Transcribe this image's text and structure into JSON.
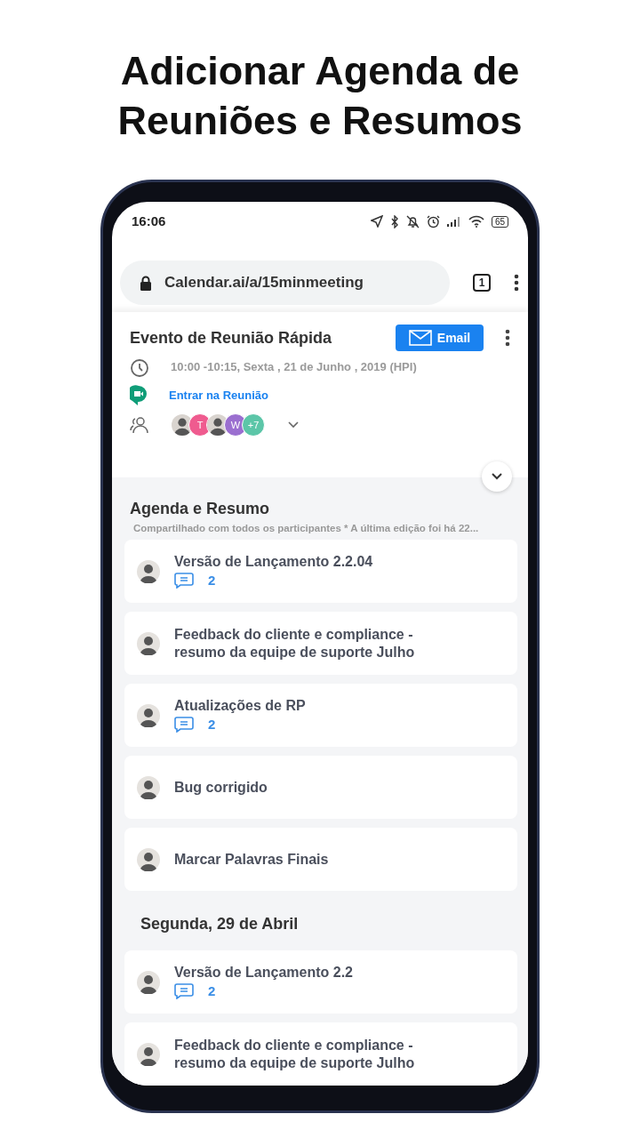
{
  "headline": [
    "Adicionar Agenda de",
    "Reuniões e Resumos"
  ],
  "status_bar": {
    "time": "16:06",
    "battery": "65"
  },
  "browser": {
    "url": "Calendar.ai/a/15minmeeting",
    "tab_count": "1"
  },
  "event": {
    "title": "Evento de Reunião Rápida",
    "email_button": "Email",
    "time": "10:00 -10:15, Sexta , 21 de Junho , 2019 (HPI)",
    "join_link": "Entrar na Reunião",
    "participants": [
      {
        "kind": "photo"
      },
      {
        "kind": "letter",
        "label": "T",
        "color": "#ef5b8f"
      },
      {
        "kind": "photo"
      },
      {
        "kind": "letter",
        "label": "W",
        "color": "#9b6fd0"
      },
      {
        "kind": "letter",
        "label": "+7",
        "color": "#5cc6a8"
      }
    ]
  },
  "agenda": {
    "title": "Agenda e Resumo",
    "subtitle": "Compartilhado com todos os participantes * A última edição foi há 22...",
    "groups": [
      {
        "items": [
          {
            "title": "Versão de Lançamento 2.2.04",
            "comments": "2"
          },
          {
            "title": "Feedback do cliente e compliance -\nresumo da equipe de suporte Julho"
          },
          {
            "title": "Atualizações de RP",
            "comments": "2"
          },
          {
            "title": "Bug corrigido"
          },
          {
            "title": "Marcar Palavras Finais"
          }
        ]
      },
      {
        "heading": "Segunda, 29 de Abril",
        "items": [
          {
            "title": "Versão de Lançamento 2.2",
            "comments": "2"
          },
          {
            "title": "Feedback do cliente e compliance -\nresumo da equipe de suporte Julho"
          }
        ]
      }
    ]
  }
}
